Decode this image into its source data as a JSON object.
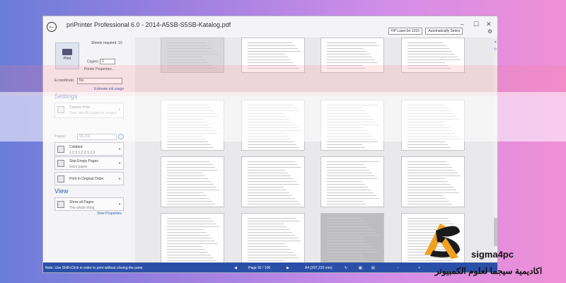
{
  "window": {
    "title": "priPrinter Professional 6.0 - 2014-A5SB-S5SB-Katalog.pdf",
    "controls": {
      "minimize": "–",
      "maximize": "☐",
      "close": "✕"
    }
  },
  "print_panel": {
    "print_label": "Print",
    "sheets_required": "Sheets required: 10",
    "copies_label": "Copies:",
    "copies_value": "1",
    "printer_properties": "Printer Properties...",
    "econo_label": "EconoMode:",
    "econo_value": "No",
    "estimate_link": "Estimate ink usage"
  },
  "settings": {
    "heading": "Settings",
    "custom_print": {
      "title": "Custom Print",
      "subtitle": "Type specific pages or ranges"
    },
    "pages_label": "Pages:",
    "pages_value": "93-102",
    "collated": {
      "title": "Collated",
      "subtitle": "1,2,3   1,2,3   1,2,3"
    },
    "skip_empty": {
      "title": "Skip Empty Pages",
      "subtitle": "Save paper"
    },
    "original_order": {
      "title": "Print In Original Order"
    }
  },
  "view": {
    "heading": "View",
    "show_all": {
      "title": "Show all Pages",
      "subtitle": "The whole thing"
    },
    "view_properties": "View Properties"
  },
  "top_bar": {
    "printer": "HP LaserJet 1015",
    "mode": "Automatically Select"
  },
  "status_bar": {
    "note": "Note: Use Shift+Click in order to print without closing the pane",
    "page": "Page 92 / 106",
    "paper": "A4 (297,210 mm)"
  },
  "watermark": {
    "brand": "sigma4pc",
    "tagline": "اكاديمية سيجما لعلوم الكمبيوتر"
  },
  "colors": {
    "status_bar": "#2a4fa6",
    "accent": "#3a5aa0",
    "logo_orange": "#f0a020"
  }
}
